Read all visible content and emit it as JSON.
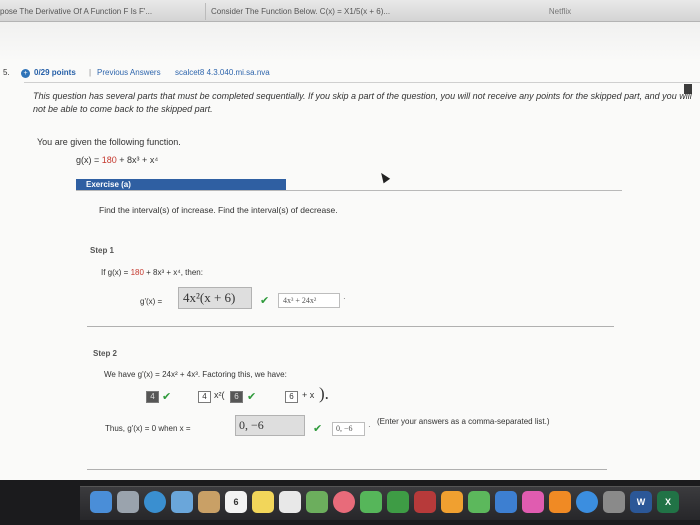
{
  "browser": {
    "tabs": [
      {
        "label": "pose The Derivative Of A Function F Is F'..."
      },
      {
        "label": "Consider The Function Below. C(x) = X1/5(x + 6)..."
      },
      {
        "label": "Netflix"
      }
    ]
  },
  "question": {
    "number": "5.",
    "points": "0/29 points",
    "separator": "|",
    "previous_answers": "Previous Answers",
    "source": "scalcet8 4.3.040.mi.sa.nva",
    "notice": "This question has several parts that must be completed sequentially. If you skip a part of the question, you will not receive any points for the skipped part, and you will not be able to come back to the skipped part.",
    "given_text": "You are given the following function.",
    "function": {
      "lhs": "g(x) = ",
      "const": "180",
      "rest": " + 8x³ + x⁴"
    }
  },
  "exercise": {
    "title": "Exercise (a)",
    "instruction": "Find the interval(s) of increase. Find the interval(s) of decrease."
  },
  "step1": {
    "label": "Step 1",
    "if_text_a": "If g(x) = ",
    "if_text_const": "180",
    "if_text_b": " + 8x³ + x⁴,  then:",
    "gprime_label": "g'(x) =",
    "answer": "4x²(x + 6)",
    "correct": "4x³ + 24x²",
    "check": "✔",
    "dot": "·"
  },
  "step2": {
    "label": "Step 2",
    "have_text": "We have g'(x) = 24x² + 4x³.  Factoring this, we have:",
    "f_box1": "4",
    "f_box2": "4",
    "f_x2": "x²(",
    "f_box3": "6",
    "f_box4": "6",
    "f_plus": "+ x",
    "thus_text": "Thus, g'(x) = 0  when x =",
    "answer": "0, −6",
    "correct": "0, −6",
    "note": "(Enter your answers as a comma-separated list.)",
    "check": "✔",
    "dot": "·"
  },
  "dock": {
    "icons": [
      {
        "name": "finder-icon",
        "label": ""
      },
      {
        "name": "launchpad-icon",
        "label": ""
      },
      {
        "name": "safari-icon",
        "label": ""
      },
      {
        "name": "mail-icon",
        "label": ""
      },
      {
        "name": "contacts-icon",
        "label": ""
      },
      {
        "name": "calendar-icon",
        "label": "6"
      },
      {
        "name": "notes-icon",
        "label": ""
      },
      {
        "name": "reminders-icon",
        "label": ""
      },
      {
        "name": "maps-icon",
        "label": ""
      },
      {
        "name": "photos-icon",
        "label": ""
      },
      {
        "name": "messages-icon",
        "label": ""
      },
      {
        "name": "facetime-icon",
        "label": ""
      },
      {
        "name": "photo-booth-icon",
        "label": ""
      },
      {
        "name": "pages-icon",
        "label": ""
      },
      {
        "name": "numbers-icon",
        "label": ""
      },
      {
        "name": "keynote-icon",
        "label": ""
      },
      {
        "name": "itunes-icon",
        "label": ""
      },
      {
        "name": "ibooks-icon",
        "label": ""
      },
      {
        "name": "app-store-icon",
        "label": ""
      },
      {
        "name": "system-preferences-icon",
        "label": ""
      },
      {
        "name": "word-icon",
        "label": "W"
      },
      {
        "name": "excel-icon",
        "label": "X"
      }
    ]
  },
  "colors": {
    "accent": "#2f5fa2",
    "correct": "#2e9a3b",
    "highlight": "#c4382e"
  }
}
